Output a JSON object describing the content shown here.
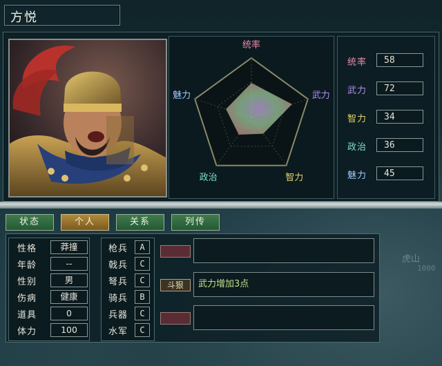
{
  "officer": {
    "name": "方悦"
  },
  "colors": {
    "leadership": "#f08aa8",
    "war": "#b08cf0",
    "intelligence": "#e6d36a",
    "politics": "#7fe0c6",
    "charm": "#9ec8ff"
  },
  "radar": {
    "labels": {
      "leadership": "统率",
      "war": "武力",
      "intelligence": "智力",
      "politics": "政治",
      "charm": "魅力"
    },
    "values": {
      "leadership": 58,
      "war": 72,
      "intelligence": 34,
      "politics": 36,
      "charm": 45
    },
    "max": 100
  },
  "stats": [
    {
      "label": "统率",
      "value": "58",
      "color": "#f08aa8"
    },
    {
      "label": "武力",
      "value": "72",
      "color": "#b08cf0"
    },
    {
      "label": "智力",
      "value": "34",
      "color": "#e6d36a"
    },
    {
      "label": "政治",
      "value": "36",
      "color": "#7fe0c6"
    },
    {
      "label": "魅力",
      "value": "45",
      "color": "#9ec8ff"
    }
  ],
  "tabs": [
    {
      "label": "状态",
      "active": false
    },
    {
      "label": "个人",
      "active": true
    },
    {
      "label": "关系",
      "active": false
    },
    {
      "label": "列传",
      "active": false
    }
  ],
  "info": [
    {
      "label": "性格",
      "value": "莽撞"
    },
    {
      "label": "年龄",
      "value": "--"
    },
    {
      "label": "性别",
      "value": "男"
    },
    {
      "label": "伤病",
      "value": "健康"
    },
    {
      "label": "道具",
      "value": "0"
    },
    {
      "label": "体力",
      "value": "100"
    }
  ],
  "troops": [
    {
      "label": "枪兵",
      "value": "A"
    },
    {
      "label": "戟兵",
      "value": "C"
    },
    {
      "label": "弩兵",
      "value": "C"
    },
    {
      "label": "骑兵",
      "value": "B"
    },
    {
      "label": "兵器",
      "value": "C"
    },
    {
      "label": "水军",
      "value": "C"
    }
  ],
  "skills": [
    {
      "tag": "",
      "desc": ""
    },
    {
      "tag": "斗狠",
      "desc": "武力增加3点"
    },
    {
      "tag": "",
      "desc": ""
    }
  ],
  "background_map": {
    "label": "虎山",
    "number": "1000"
  }
}
